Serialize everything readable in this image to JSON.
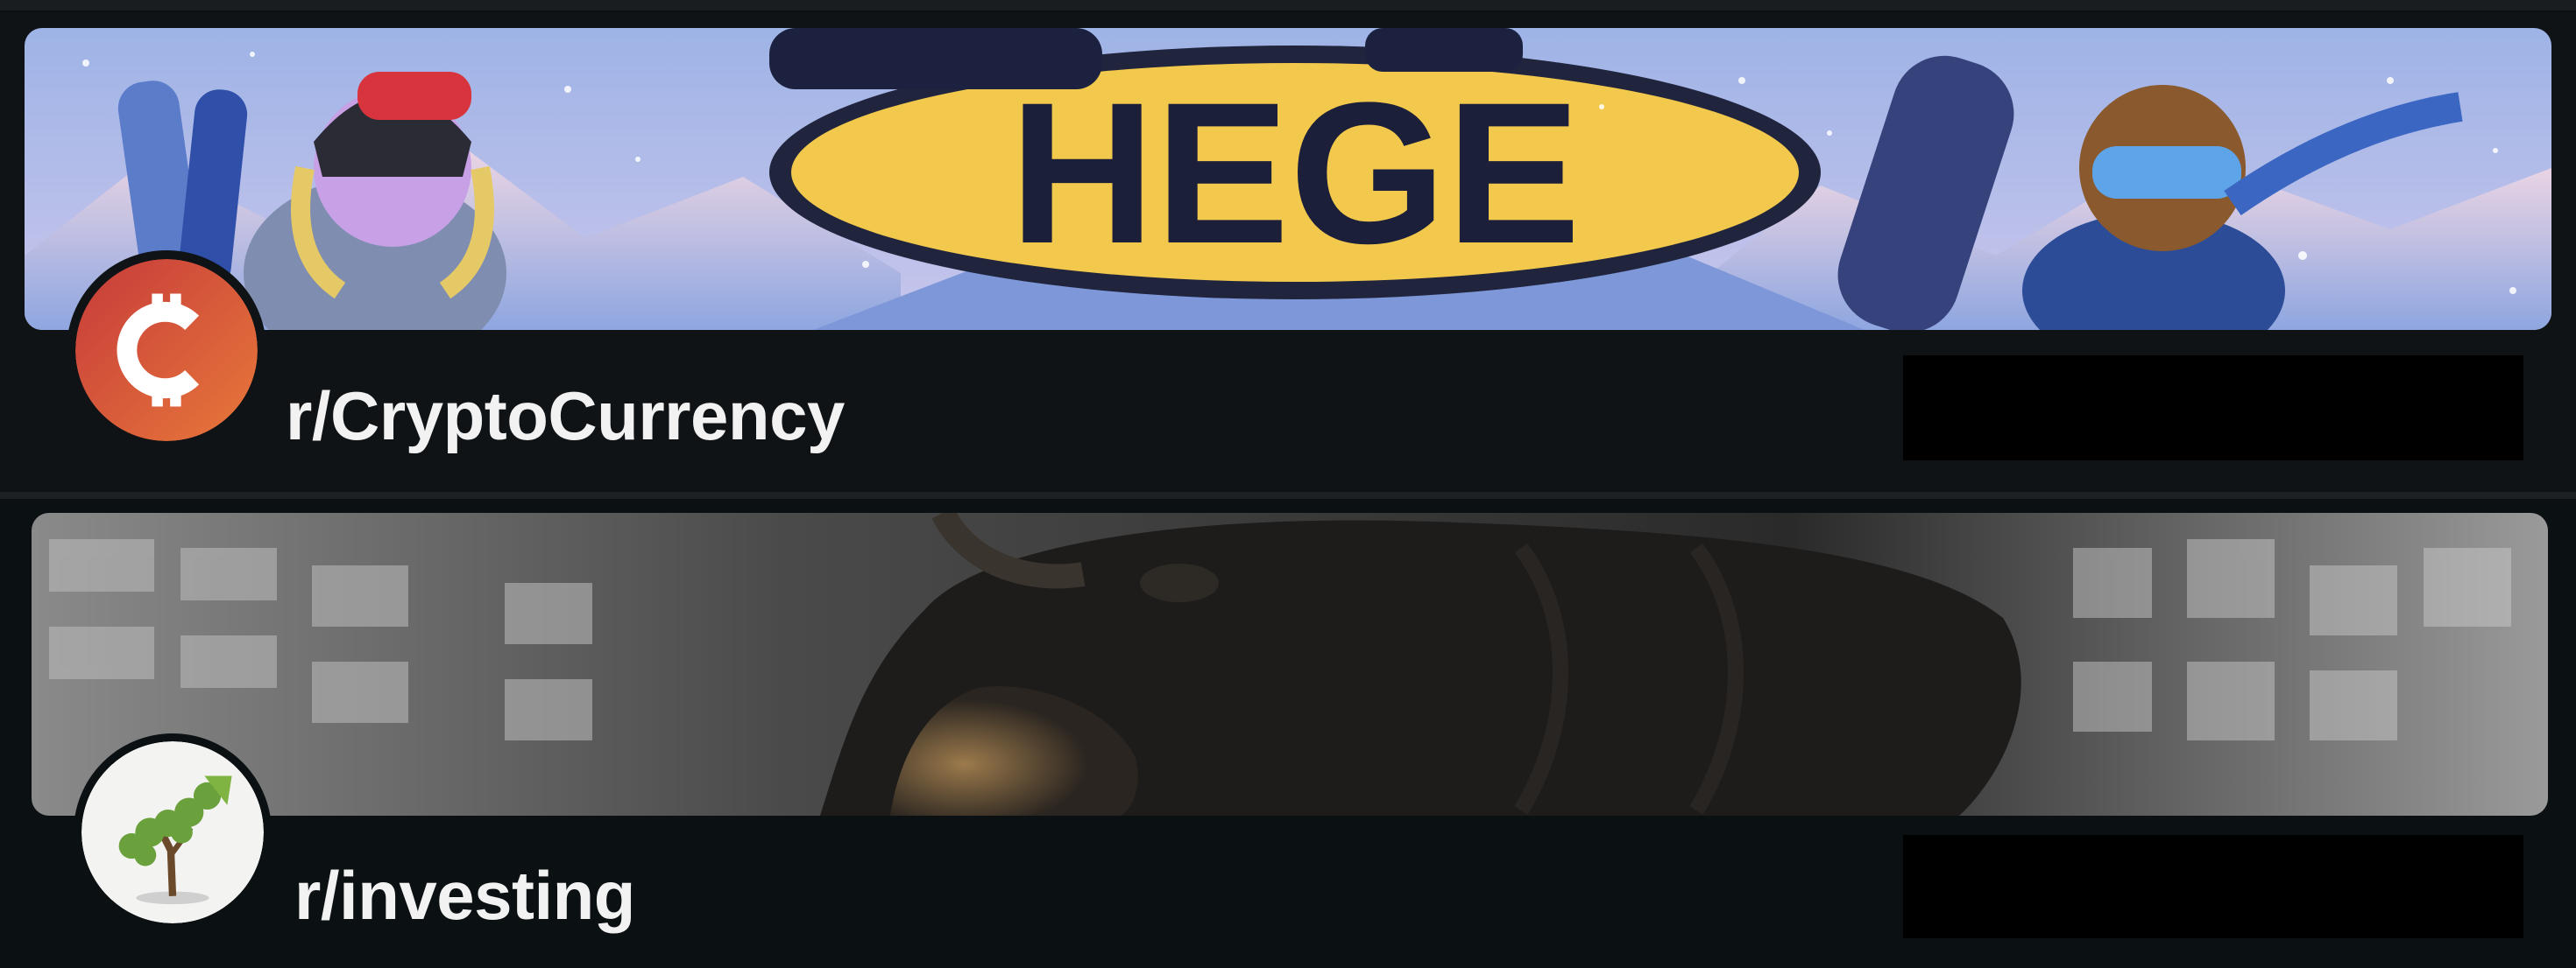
{
  "communities": [
    {
      "name": "r/CryptoCurrency",
      "banner_text": "HEGE",
      "avatar_icon": "crypto-coin-icon",
      "accent": "#e8643c"
    },
    {
      "name": "r/investing",
      "avatar_icon": "growth-tree-icon",
      "accent": "#7fb342"
    }
  ],
  "colors": {
    "background": "#0c1013",
    "text": "#f2f2f2",
    "redaction": "#000000"
  }
}
